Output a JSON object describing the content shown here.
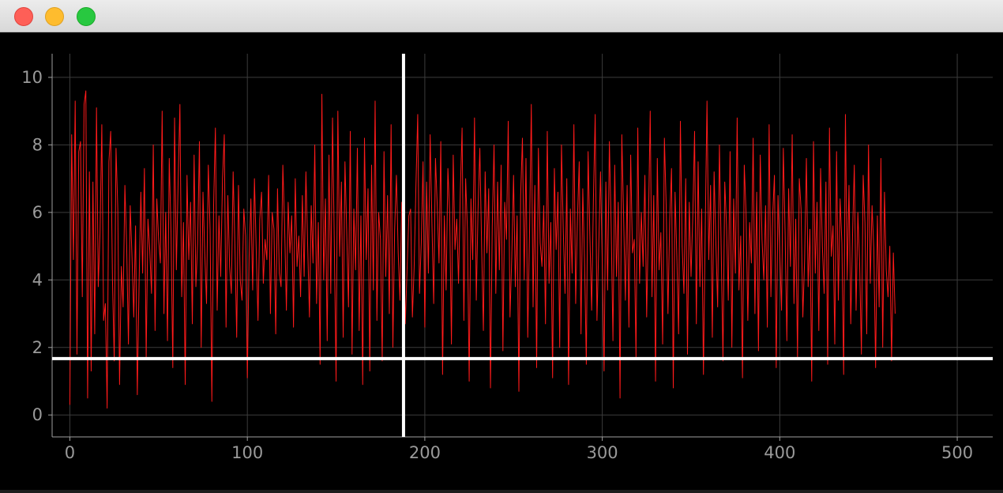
{
  "window": {
    "buttons": [
      "close",
      "minimize",
      "maximize"
    ]
  },
  "chart_data": {
    "type": "line",
    "title": "",
    "xlabel": "",
    "ylabel": "",
    "xlim": [
      -10,
      520
    ],
    "ylim": [
      -0.65,
      10.7
    ],
    "xticks": [
      0,
      100,
      200,
      300,
      400,
      500
    ],
    "yticks": [
      0,
      2,
      4,
      6,
      8,
      10
    ],
    "grid": true,
    "colors": {
      "line": "#ff1a1a",
      "crosshair": "#ffffff",
      "grid": "#3c3c3c",
      "axis": "#a0a0a0",
      "tick_label": "#9a9a9a"
    },
    "crosshair": {
      "x": 188,
      "y": 1.67
    },
    "series": [
      {
        "name": "",
        "x_start": 0,
        "x_step": 1,
        "values": [
          0.3,
          8.3,
          4.6,
          9.3,
          1.8,
          7.8,
          8.1,
          3.5,
          9.2,
          9.6,
          0.5,
          7.2,
          1.3,
          6.9,
          2.4,
          9.1,
          3.8,
          5.4,
          8.6,
          2.8,
          3.3,
          0.2,
          7.5,
          8.4,
          4.0,
          1.6,
          7.9,
          6.1,
          0.9,
          4.4,
          3.2,
          6.8,
          5.0,
          2.1,
          6.2,
          4.7,
          2.9,
          5.6,
          0.6,
          3.9,
          6.6,
          4.2,
          7.3,
          1.7,
          5.8,
          4.9,
          3.6,
          8.0,
          2.5,
          6.4,
          5.2,
          4.5,
          9.0,
          3.0,
          6.0,
          2.2,
          7.6,
          5.4,
          1.4,
          8.8,
          4.3,
          6.9,
          9.2,
          3.5,
          5.7,
          0.9,
          7.1,
          4.6,
          6.3,
          2.7,
          7.7,
          3.8,
          5.1,
          8.1,
          2.0,
          6.6,
          4.8,
          3.3,
          7.4,
          5.5,
          0.4,
          6.2,
          8.5,
          3.1,
          5.9,
          4.1,
          7.0,
          8.3,
          2.6,
          6.5,
          4.4,
          3.6,
          7.2,
          5.0,
          2.3,
          6.8,
          4.0,
          3.4,
          6.1,
          5.3,
          1.1,
          4.7,
          6.4,
          3.7,
          7.0,
          4.9,
          2.8,
          5.8,
          6.6,
          3.9,
          5.2,
          4.6,
          7.1,
          3.0,
          6.0,
          5.5,
          2.4,
          6.7,
          4.2,
          3.8,
          7.4,
          5.6,
          3.1,
          6.3,
          4.8,
          5.9,
          2.6,
          7.0,
          4.4,
          5.3,
          3.5,
          6.5,
          4.1,
          7.2,
          5.0,
          2.9,
          6.2,
          4.5,
          8.0,
          3.3,
          5.7,
          1.5,
          9.5,
          4.0,
          6.4,
          2.2,
          7.7,
          3.6,
          8.8,
          5.1,
          1.0,
          9.0,
          4.7,
          6.9,
          2.3,
          7.5,
          5.4,
          3.2,
          8.4,
          1.8,
          6.1,
          4.3,
          7.9,
          2.5,
          5.9,
          0.9,
          8.2,
          4.6,
          6.7,
          1.3,
          7.4,
          3.7,
          9.3,
          2.8,
          6.0,
          5.2,
          1.6,
          7.8,
          4.1,
          6.5,
          3.0,
          8.6,
          2.0,
          5.5,
          7.1,
          4.8,
          3.4,
          6.3,
          5.6,
          2.7,
          4.3,
          5.9,
          6.1,
          2.9,
          4.4,
          6.8,
          8.9,
          3.6,
          5.1,
          7.5,
          2.6,
          6.9,
          4.2,
          8.3,
          5.7,
          3.3,
          7.6,
          6.2,
          4.5,
          8.1,
          1.2,
          5.9,
          3.7,
          7.3,
          6.0,
          2.1,
          7.7,
          4.9,
          5.8,
          3.9,
          6.6,
          8.5,
          2.8,
          7.0,
          5.5,
          1.0,
          6.4,
          4.6,
          8.8,
          3.4,
          6.1,
          7.9,
          5.0,
          2.5,
          7.2,
          4.8,
          6.7,
          0.8,
          5.6,
          8.0,
          3.6,
          6.9,
          4.3,
          7.4,
          1.9,
          6.3,
          5.2,
          8.7,
          2.9,
          4.7,
          7.1,
          3.8,
          5.9,
          0.7,
          6.5,
          8.2,
          4.0,
          7.6,
          2.3,
          5.4,
          9.2,
          3.2,
          6.8,
          1.4,
          7.9,
          5.1,
          4.4,
          6.2,
          2.7,
          8.4,
          3.9,
          5.7,
          1.1,
          7.3,
          4.9,
          6.6,
          2.0,
          8.0,
          5.5,
          3.6,
          7.0,
          0.9,
          6.1,
          4.2,
          8.6,
          3.3,
          5.8,
          7.5,
          2.4,
          6.7,
          4.6,
          1.5,
          7.8,
          5.3,
          3.1,
          6.4,
          8.9,
          2.8,
          5.0,
          7.2,
          4.5,
          1.3,
          6.9,
          3.7,
          8.1,
          5.6,
          2.2,
          7.4,
          4.1,
          6.3,
          0.5,
          8.3,
          5.9,
          3.4,
          6.8,
          2.6,
          7.7,
          4.8,
          5.2,
          1.7,
          8.5,
          3.9,
          6.0,
          4.4,
          7.1,
          2.9,
          5.7,
          9.0,
          3.5,
          6.5,
          1.0,
          7.6,
          4.3,
          5.4,
          2.1,
          8.2,
          6.2,
          3.0,
          5.8,
          7.3,
          0.8,
          6.6,
          4.7,
          2.4,
          8.7,
          5.0,
          3.6,
          7.0,
          1.8,
          6.3,
          4.1,
          5.9,
          8.4,
          2.7,
          7.5,
          3.8,
          6.1,
          1.2,
          5.5,
          9.3,
          4.6,
          6.8,
          2.3,
          7.2,
          5.1,
          3.2,
          8.0,
          4.9,
          1.6,
          6.9,
          5.6,
          3.4,
          7.8,
          2.0,
          6.4,
          4.2,
          8.8,
          3.7,
          5.3,
          1.1,
          7.4,
          6.0,
          2.8,
          5.7,
          4.5,
          8.2,
          3.0,
          6.6,
          1.9,
          7.7,
          5.2,
          4.0,
          6.2,
          2.6,
          8.6,
          3.5,
          5.9,
          7.1,
          1.4,
          6.5,
          4.8,
          3.1,
          7.9,
          5.4,
          2.2,
          6.7,
          4.4,
          8.3,
          3.3,
          5.8,
          1.7,
          7.0,
          6.1,
          2.9,
          4.6,
          7.6,
          3.8,
          5.5,
          1.0,
          8.1,
          4.2,
          6.3,
          2.5,
          7.3,
          5.0,
          3.6,
          6.9,
          1.5,
          8.5,
          4.7,
          5.6,
          2.1,
          7.8,
          3.4,
          6.4,
          5.1,
          1.2,
          8.9,
          4.0,
          6.8,
          2.7,
          5.3,
          7.4,
          3.1,
          6.0,
          4.5,
          1.8,
          7.1,
          5.7,
          2.4,
          8.0,
          3.9,
          6.2,
          4.9,
          1.4,
          5.9,
          3.2,
          7.6,
          2.0,
          6.6,
          4.3,
          3.5,
          5.0,
          1.6,
          4.8,
          3.0
        ]
      }
    ]
  }
}
